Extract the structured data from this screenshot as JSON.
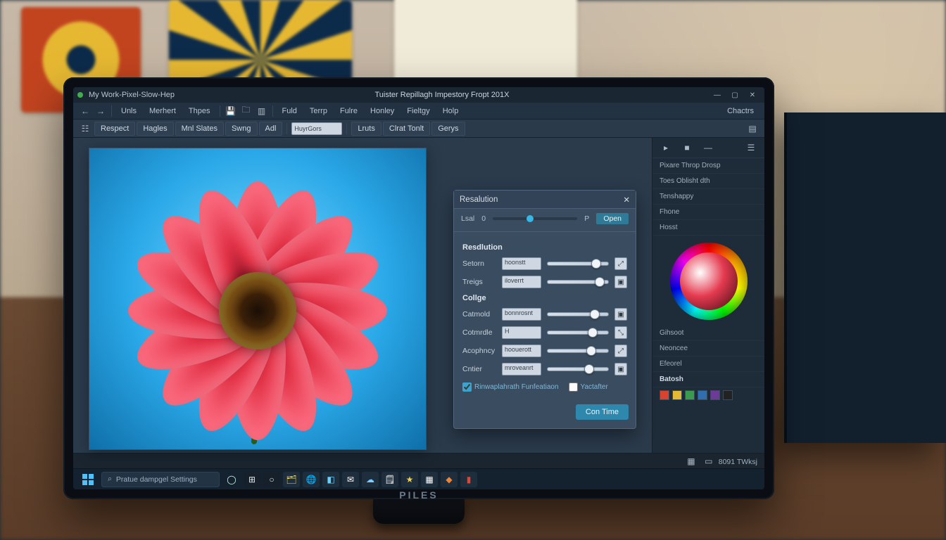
{
  "env": {
    "monitor_brand": "PILES"
  },
  "app": {
    "doc_label_left": "My Work-Pixel-Slow-Hep",
    "title": "Tuister Repillagh Impestory Fropt 201X"
  },
  "menubar": {
    "items": [
      "Unls",
      "Merhert",
      "Thpes"
    ],
    "items2": [
      "Fuld",
      "Terrp",
      "Fulre",
      "Honley",
      "Fieltgy",
      "Holp"
    ],
    "right": "Chactrs"
  },
  "toolbar": {
    "buttons1": [
      "Respect",
      "Hagles",
      "Mnl Slates",
      "Swng",
      "Adl"
    ],
    "field_value": "HuyrGors",
    "buttons2": [
      "Lruts",
      "Clrat Tonlt",
      "Gerys"
    ]
  },
  "panel": {
    "title": "Resalution",
    "top_label": "Lsal",
    "top_value": "0",
    "top_unit": "P",
    "top_action": "Open",
    "section1": "Resdlution",
    "section2": "Collge",
    "sliders": [
      {
        "label": "Setorn",
        "box": "hoonstt",
        "pos": 72,
        "icon": "⤢"
      },
      {
        "label": "Treigs",
        "box": "iloverrt",
        "pos": 78,
        "icon": ""
      },
      {
        "label": "Catmold",
        "box": "bonnrosnt",
        "pos": 70,
        "icon": ""
      },
      {
        "label": "Cotmrdle",
        "box": "H",
        "pos": 66,
        "icon": "⤡"
      },
      {
        "label": "Acophncy",
        "box": "hoouerott",
        "pos": 64,
        "icon": "⤢"
      },
      {
        "label": "Cntier",
        "box": "mroveanrt",
        "pos": 60,
        "icon": ""
      }
    ],
    "check1": "Rinwaplahrath Funfeatiaon",
    "check2": "Yactafter",
    "confirm": "Con Time"
  },
  "dock": {
    "rows": [
      "Pixare Throp Drosp",
      "Toes Oblisht dth",
      "Tenshappy",
      "Fhone",
      "Hosst"
    ],
    "sec2": [
      "Gihsoot",
      "Neoncee",
      "Efeorel"
    ],
    "sec3_title": "Batosh"
  },
  "statusbar": {
    "left": "",
    "right": "8091  TWksj"
  },
  "taskbar": {
    "search": "Pratue dampgel Settings",
    "pins": [
      {
        "bg": "#15202b",
        "fg": "#e4e9ee",
        "ch": "⊞"
      },
      {
        "bg": "#15202b",
        "fg": "#e4e9ee",
        "ch": "○"
      },
      {
        "bg": "#1f2e3d",
        "fg": "#e6d15a",
        "ch": "🗂"
      },
      {
        "bg": "#1f2e3d",
        "fg": "#ffffff",
        "ch": "🌐"
      },
      {
        "bg": "#1f2e3d",
        "fg": "#65d1ff",
        "ch": "◧"
      },
      {
        "bg": "#1f2e3d",
        "fg": "#ffffff",
        "ch": "✉"
      },
      {
        "bg": "#1f2e3d",
        "fg": "#7ecbff",
        "ch": "☁"
      },
      {
        "bg": "#1f2e3d",
        "fg": "#ffffff",
        "ch": "🗒"
      },
      {
        "bg": "#1f2e3d",
        "fg": "#f0d24a",
        "ch": "★"
      },
      {
        "bg": "#1f2e3d",
        "fg": "#ffffff",
        "ch": "▦"
      },
      {
        "bg": "#1f2e3d",
        "fg": "#e8863a",
        "ch": "◆"
      },
      {
        "bg": "#1f2e3d",
        "fg": "#d74a3a",
        "ch": "▮"
      }
    ]
  },
  "swatches": [
    "#d9432e",
    "#e6b832",
    "#3a9a4d",
    "#2f6fb0",
    "#6d3a9a",
    "#222"
  ]
}
